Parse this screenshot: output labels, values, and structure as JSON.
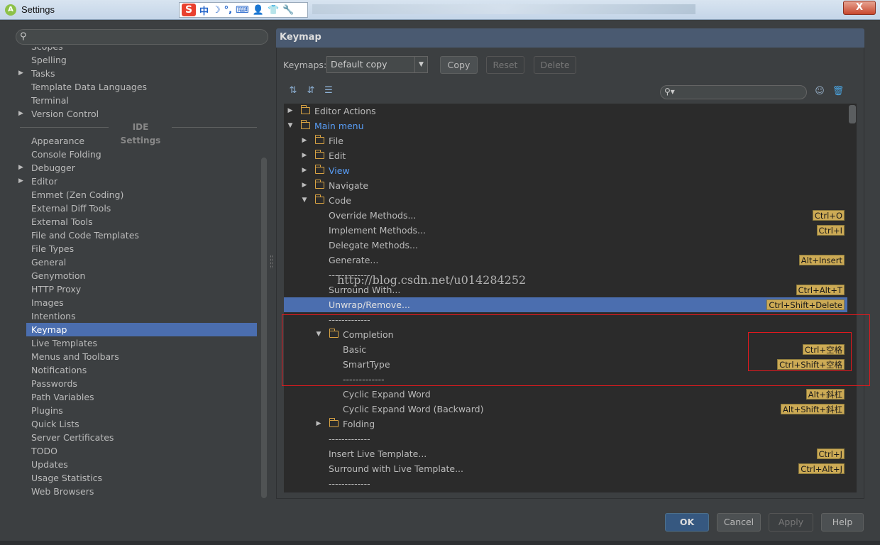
{
  "window": {
    "title": "Settings",
    "close_label": "X"
  },
  "ime": {
    "brand": "S",
    "items": [
      "中",
      "☽",
      "°,",
      "⌨",
      "👤",
      "👕",
      "🔧"
    ]
  },
  "left": {
    "search_placeholder": "",
    "top_items": [
      {
        "label": "Scopes",
        "arrow": false
      },
      {
        "label": "Spelling",
        "arrow": false
      },
      {
        "label": "Tasks",
        "arrow": true
      },
      {
        "label": "Template Data Languages",
        "arrow": false
      },
      {
        "label": "Terminal",
        "arrow": false
      },
      {
        "label": "Version Control",
        "arrow": true
      }
    ],
    "section": "IDE Settings",
    "ide_items": [
      {
        "label": "Appearance",
        "arrow": false
      },
      {
        "label": "Console Folding",
        "arrow": false
      },
      {
        "label": "Debugger",
        "arrow": true
      },
      {
        "label": "Editor",
        "arrow": true
      },
      {
        "label": "Emmet (Zen Coding)",
        "arrow": false
      },
      {
        "label": "External Diff Tools",
        "arrow": false
      },
      {
        "label": "External Tools",
        "arrow": false
      },
      {
        "label": "File and Code Templates",
        "arrow": false
      },
      {
        "label": "File Types",
        "arrow": false
      },
      {
        "label": "General",
        "arrow": false
      },
      {
        "label": "Genymotion",
        "arrow": false
      },
      {
        "label": "HTTP Proxy",
        "arrow": false
      },
      {
        "label": "Images",
        "arrow": false
      },
      {
        "label": "Intentions",
        "arrow": false
      },
      {
        "label": "Keymap",
        "arrow": false,
        "selected": true
      },
      {
        "label": "Live Templates",
        "arrow": false
      },
      {
        "label": "Menus and Toolbars",
        "arrow": false
      },
      {
        "label": "Notifications",
        "arrow": false
      },
      {
        "label": "Passwords",
        "arrow": false
      },
      {
        "label": "Path Variables",
        "arrow": false
      },
      {
        "label": "Plugins",
        "arrow": false
      },
      {
        "label": "Quick Lists",
        "arrow": false
      },
      {
        "label": "Server Certificates",
        "arrow": false
      },
      {
        "label": "TODO",
        "arrow": false
      },
      {
        "label": "Updates",
        "arrow": false
      },
      {
        "label": "Usage Statistics",
        "arrow": false
      },
      {
        "label": "Web Browsers",
        "arrow": false
      }
    ]
  },
  "keymap": {
    "header": "Keymap",
    "keymaps_label": "Keymaps:",
    "keymap_value": "Default copy",
    "buttons": {
      "copy": "Copy",
      "reset": "Reset",
      "delete": "Delete"
    },
    "search_value": "",
    "rows": [
      {
        "level": 0,
        "arrow": "right",
        "folder": true,
        "label": "Editor Actions",
        "style": "normal"
      },
      {
        "level": 0,
        "arrow": "down",
        "folder": true,
        "label": "Main menu",
        "style": "blue"
      },
      {
        "level": 1,
        "arrow": "right",
        "folder": true,
        "label": "File",
        "style": "normal"
      },
      {
        "level": 1,
        "arrow": "right",
        "folder": true,
        "label": "Edit",
        "style": "normal"
      },
      {
        "level": 1,
        "arrow": "right",
        "folder": true,
        "label": "View",
        "style": "blue"
      },
      {
        "level": 1,
        "arrow": "right",
        "folder": true,
        "label": "Navigate",
        "style": "normal"
      },
      {
        "level": 1,
        "arrow": "down",
        "folder": true,
        "label": "Code",
        "style": "normal"
      },
      {
        "level": 2,
        "label": "Override Methods...",
        "shortcut": "Ctrl+O"
      },
      {
        "level": 2,
        "label": "Implement Methods...",
        "shortcut": "Ctrl+I"
      },
      {
        "level": 2,
        "label": "Delegate Methods..."
      },
      {
        "level": 2,
        "label": "Generate...",
        "shortcut": "Alt+Insert"
      },
      {
        "level": 2,
        "label": "-------------"
      },
      {
        "level": 2,
        "label": "Surround With...",
        "shortcut": "Ctrl+Alt+T"
      },
      {
        "level": 2,
        "label": "Unwrap/Remove...",
        "shortcut": "Ctrl+Shift+Delete",
        "selected": true
      },
      {
        "level": 2,
        "label": "-------------"
      },
      {
        "level": 2,
        "arrow": "down",
        "folder": true,
        "label": "Completion",
        "style": "normal"
      },
      {
        "level": 3,
        "label": "Basic",
        "shortcut": "Ctrl+空格"
      },
      {
        "level": 3,
        "label": "SmartType",
        "shortcut": "Ctrl+Shift+空格"
      },
      {
        "level": 3,
        "label": "-------------"
      },
      {
        "level": 3,
        "label": "Cyclic Expand Word",
        "shortcut": "Alt+斜杠"
      },
      {
        "level": 3,
        "label": "Cyclic Expand Word (Backward)",
        "shortcut": "Alt+Shift+斜杠"
      },
      {
        "level": 2,
        "arrow": "right",
        "folder": true,
        "label": "Folding",
        "style": "normal"
      },
      {
        "level": 2,
        "label": "-------------"
      },
      {
        "level": 2,
        "label": "Insert Live Template...",
        "shortcut": "Ctrl+J"
      },
      {
        "level": 2,
        "label": "Surround with Live Template...",
        "shortcut": "Ctrl+Alt+J"
      },
      {
        "level": 2,
        "label": "-------------"
      }
    ],
    "watermark": "http://blog.csdn.net/u014284252"
  },
  "footer": {
    "ok": "OK",
    "cancel": "Cancel",
    "apply": "Apply",
    "help": "Help"
  },
  "colors": {
    "selection": "#4b6eaf",
    "shortcut_bg": "#ccaa55",
    "highlight_box": "#e0191e",
    "link": "#589df6"
  }
}
